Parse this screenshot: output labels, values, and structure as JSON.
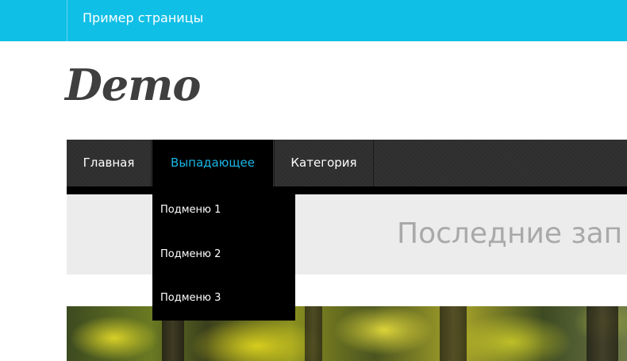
{
  "topbar": {
    "link_label": "Пример страницы",
    "color": "#0fbfe6"
  },
  "header": {
    "logo_text": "Demo"
  },
  "nav": {
    "items": [
      {
        "label": "Главная"
      },
      {
        "label": "Выпадающее",
        "active": true
      },
      {
        "label": "Категория"
      }
    ],
    "active_color": "#19b5e5",
    "submenu": [
      {
        "label": "Подменю 1"
      },
      {
        "label": "Подменю 2"
      },
      {
        "label": "Подменю 3"
      }
    ]
  },
  "main": {
    "section_title": "Последние зап"
  },
  "hero": {
    "image_semantic": "forest-image"
  }
}
